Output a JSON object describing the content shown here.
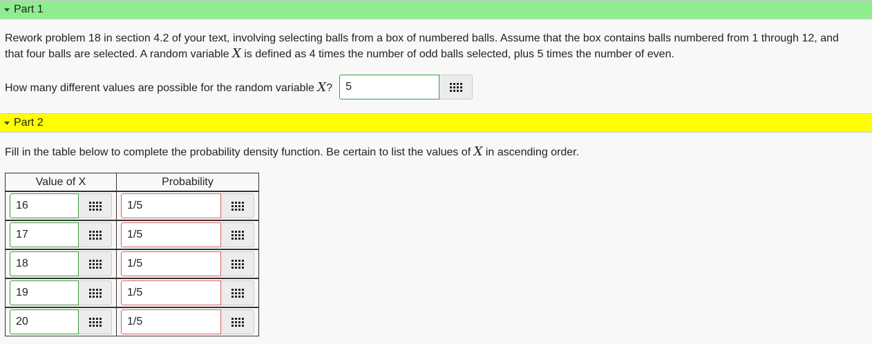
{
  "part1": {
    "title": "Part 1",
    "problem_text_a": "Rework problem 18 in section 4.2 of your text, involving selecting balls from a box of numbered balls. Assume that the box contains balls numbered from 1 through 12, and that four balls are selected. A random variable ",
    "problem_var": "X",
    "problem_text_b": " is defined as 4 times the number of odd balls selected, plus 5 times the number of even.",
    "question_a": "How many different values are possible for the random variable ",
    "question_var": "X",
    "question_b": "?",
    "answer": "5"
  },
  "part2": {
    "title": "Part 2",
    "instruction_a": "Fill in the table below to complete the probability density function. Be certain to list the values of ",
    "instruction_var": "X",
    "instruction_b": " in ascending order.",
    "columns": [
      "Value of X",
      "Probability"
    ],
    "rows": [
      {
        "value": "16",
        "probability": "1/5"
      },
      {
        "value": "17",
        "probability": "1/5"
      },
      {
        "value": "18",
        "probability": "1/5"
      },
      {
        "value": "19",
        "probability": "1/5"
      },
      {
        "value": "20",
        "probability": "1/5"
      }
    ]
  },
  "icons": {
    "collapse": "caret-down-icon",
    "equation_editor": "grid-icon"
  },
  "colors": {
    "part1_header": "#8eed8e",
    "part2_header": "#ffff00",
    "correct_border": "#3a9a3a",
    "incorrect_border": "#e06060"
  }
}
